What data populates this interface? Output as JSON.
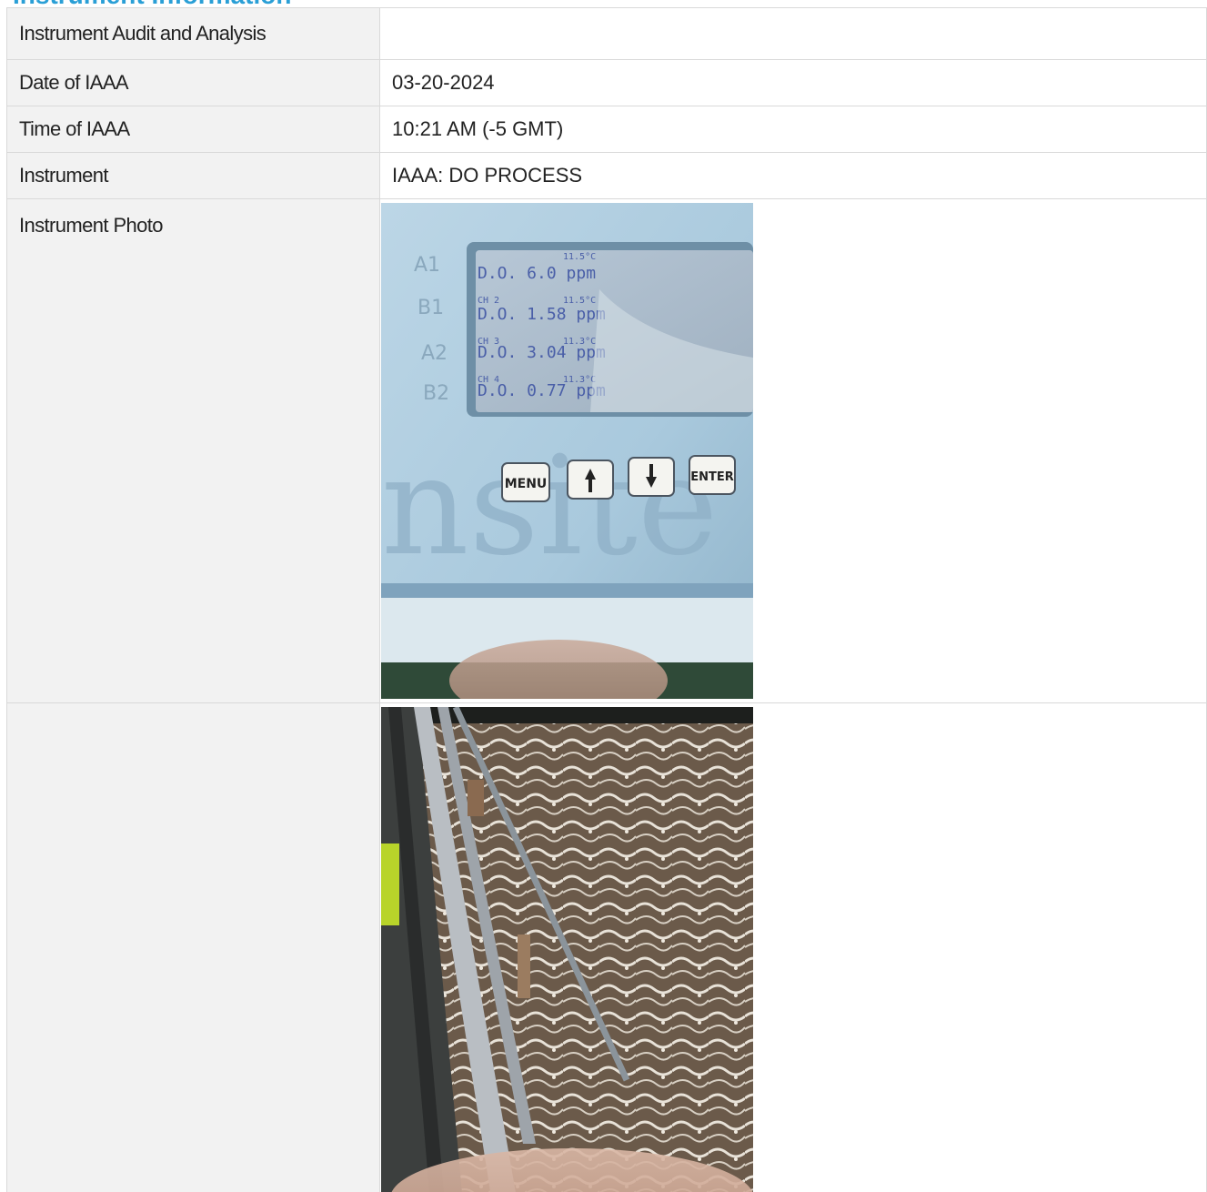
{
  "section": {
    "title": "Instrument Information"
  },
  "rows": [
    {
      "label": "Instrument Audit and Analysis",
      "value": ""
    },
    {
      "label": "Date of IAAA",
      "value": "03-20-2024"
    },
    {
      "label": "Time of IAAA",
      "value": "10:21 AM (-5 GMT)"
    },
    {
      "label": "Instrument",
      "value": "IAAA: DO PROCESS"
    },
    {
      "label": "Instrument Photo",
      "value": ""
    }
  ],
  "photo1": {
    "handwriting": [
      "A1",
      "B1",
      "A2",
      "B2"
    ],
    "display_lines": [
      {
        "ch": "",
        "temp": "11.5°C",
        "reading": "D.O.  6.0 ppm"
      },
      {
        "ch": "CH 2",
        "temp": "11.5°C",
        "reading": "D.O. 1.58 ppm"
      },
      {
        "ch": "CH 3",
        "temp": "11.3°C",
        "reading": "D.O. 3.04 ppm"
      },
      {
        "ch": "CH 4",
        "temp": "11.3°C",
        "reading": "D.O. 0.77 ppm"
      }
    ],
    "buttons": {
      "menu": "MENU",
      "enter": "ENTER"
    },
    "logo_text": "nsite"
  },
  "colors": {
    "title": "#2a9fd6",
    "label_bg": "#f2f2f2",
    "border": "#d9d9d9"
  }
}
